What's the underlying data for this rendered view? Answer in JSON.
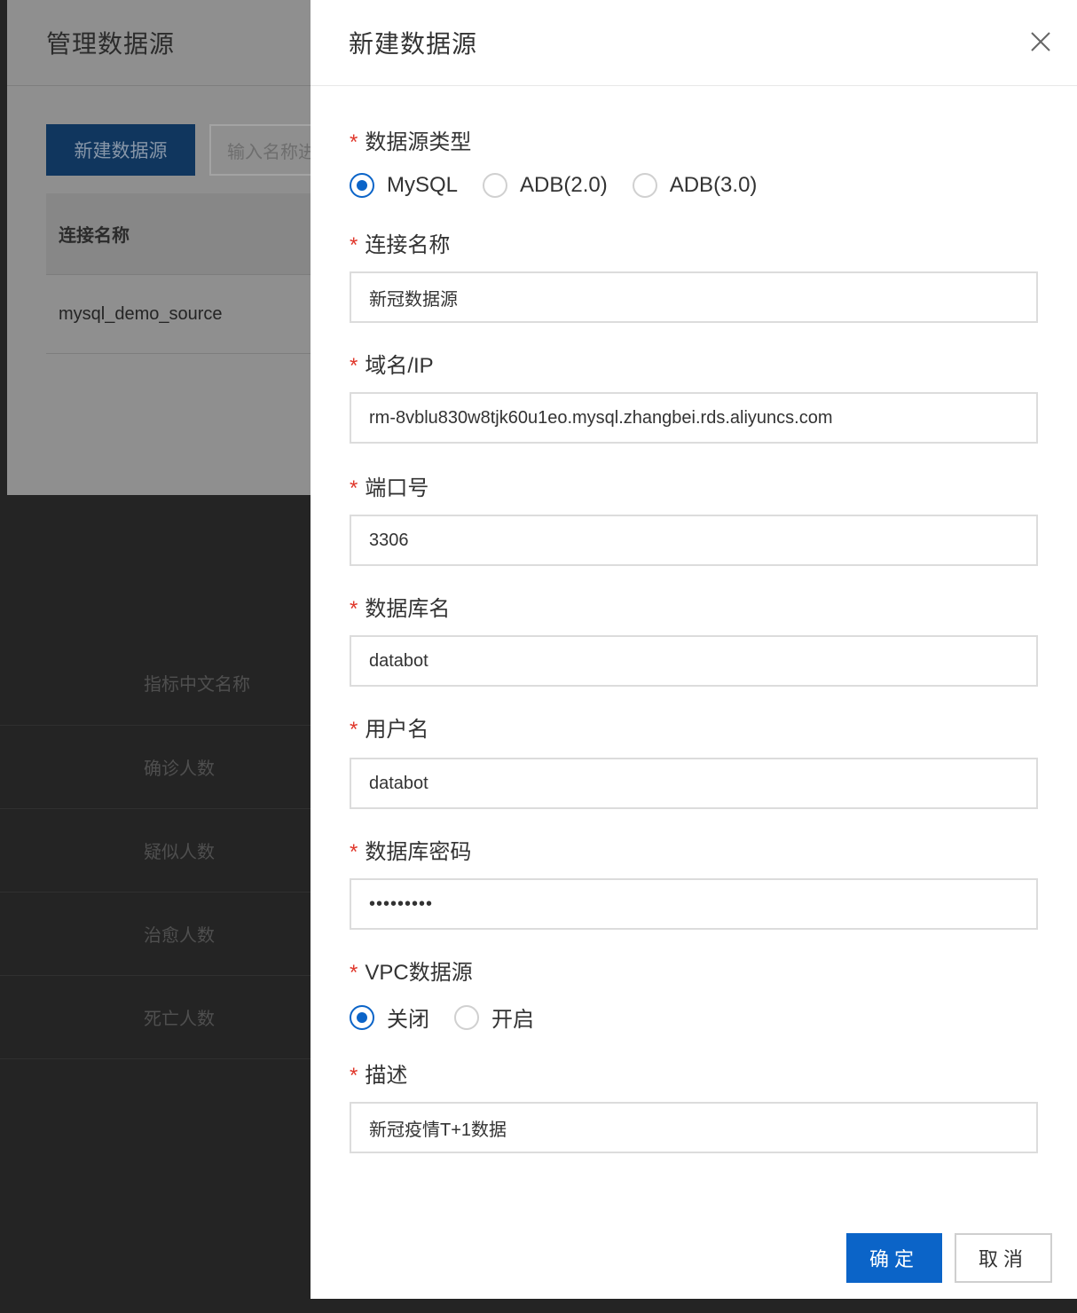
{
  "background": {
    "panel_title": "管理数据源",
    "new_button_label": "新建数据源",
    "search_placeholder": "输入名称进",
    "table_header": "连接名称",
    "table_rows": [
      "mysql_demo_source"
    ],
    "metrics_header": "指标中文名称",
    "metrics_rows": [
      "确诊人数",
      "疑似人数",
      "治愈人数",
      "死亡人数"
    ]
  },
  "drawer": {
    "title": "新建数据源",
    "close_icon": "close-icon",
    "fields": {
      "type": {
        "label": "数据源类型",
        "options": [
          "MySQL",
          "ADB(2.0)",
          "ADB(3.0)"
        ],
        "selected": "MySQL"
      },
      "name": {
        "label": "连接名称",
        "value": "新冠数据源"
      },
      "host": {
        "label": "域名/IP",
        "value": "rm-8vblu830w8tjk60u1eo.mysql.zhangbei.rds.aliyuncs.com"
      },
      "port": {
        "label": "端口号",
        "value": "3306"
      },
      "database": {
        "label": "数据库名",
        "value": "databot"
      },
      "username": {
        "label": "用户名",
        "value": "databot"
      },
      "password": {
        "label": "数据库密码",
        "value": "•••••••••"
      },
      "vpc": {
        "label": "VPC数据源",
        "options": [
          "关闭",
          "开启"
        ],
        "selected": "关闭"
      },
      "description": {
        "label": "描述",
        "value": "新冠疫情T+1数据"
      }
    },
    "required_mark": "*",
    "buttons": {
      "confirm": "确定",
      "cancel": "取消"
    }
  },
  "colors": {
    "primary": "#0b64c8",
    "required": "#e0372b",
    "overlay": "#242424"
  }
}
